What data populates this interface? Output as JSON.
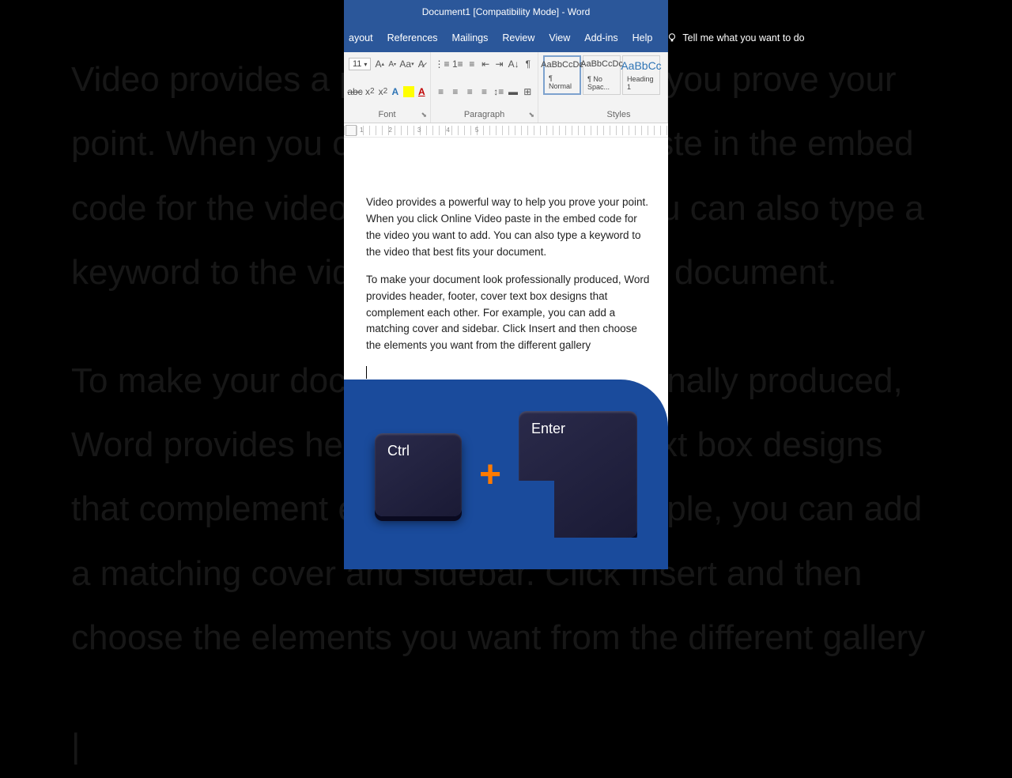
{
  "bg": {
    "p1": "Video provides a powerful way to help you prove your point. When you click Online Video paste in the embed code for the video you want to add. You can also type a keyword to the video that best fits your document.",
    "p2": "To make your document look professionally produced, Word provides header, footer, cover text box designs that complement each other. For example, you can add a matching cover and sidebar. Click Insert and then choose the elements you want from the different gallery"
  },
  "title": "Document1 [Compatibility Mode]  -  Word",
  "menu": {
    "layout": "ayout",
    "references": "References",
    "mailings": "Mailings",
    "review": "Review",
    "view": "View",
    "addins": "Add-ins",
    "help": "Help",
    "tellme": "Tell me what you want to do"
  },
  "ribbon": {
    "fontSize": "11",
    "fontGroup": "Font",
    "paraGroup": "Paragraph",
    "stylesGroup": "Styles",
    "styles": [
      {
        "sample": "AaBbCcDc",
        "name": "¶ Normal"
      },
      {
        "sample": "AaBbCcDc",
        "name": "¶ No Spac..."
      },
      {
        "sample": "AaBbCc",
        "name": "Heading 1"
      }
    ]
  },
  "doc": {
    "p1": "Video provides a powerful way to help you prove your point. When you click Online Video paste in the embed code for the video you want to add. You can also type a keyword to the video that best fits your document.",
    "p2": "To make your document look professionally produced, Word provides header, footer, cover text box designs that complement each other. For example, you can add a matching cover and sidebar. Click Insert and then choose the elements you want from the different gallery"
  },
  "kb": {
    "ctrl": "Ctrl",
    "plus": "+",
    "enter": "Enter"
  }
}
